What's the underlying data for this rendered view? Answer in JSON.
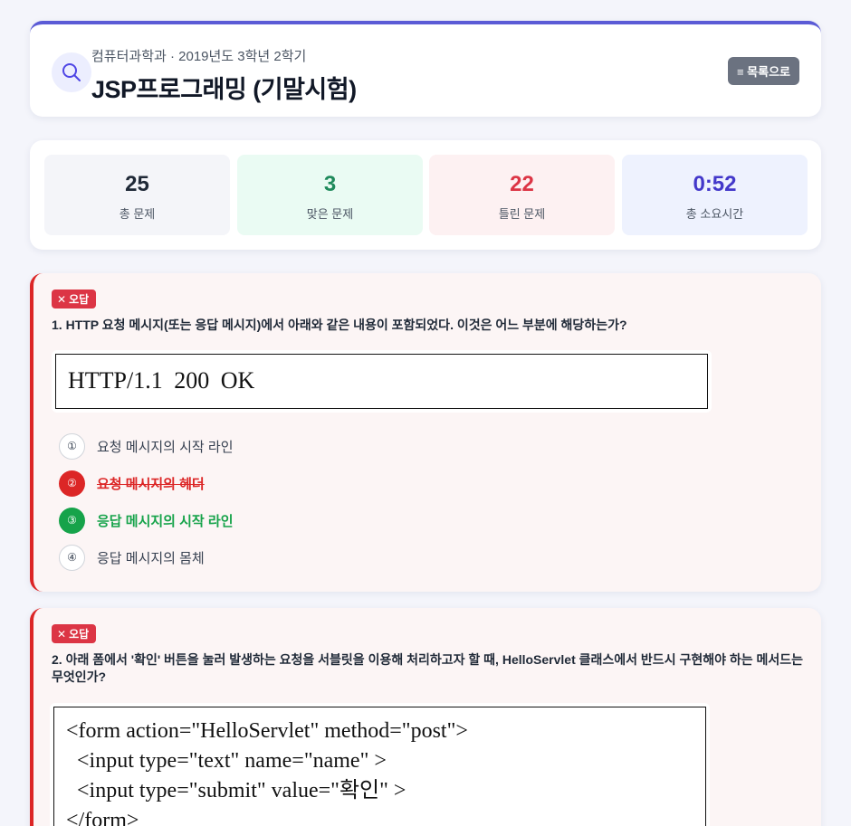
{
  "header": {
    "subtitle": "컴퓨터과학과 · 2019년도 3학년 2학기",
    "title": "JSP프로그래밍 (기말시험)",
    "list_button": "≡ 목록으로"
  },
  "stats": [
    {
      "value": "25",
      "label": "총 문제",
      "color": "#1f2937",
      "bg": "#f4f5f9"
    },
    {
      "value": "3",
      "label": "맞은 문제",
      "color": "#1f8a5b",
      "bg": "#eafbf3"
    },
    {
      "value": "22",
      "label": "틀린 문제",
      "color": "#dc3545",
      "bg": "#fdf1f2"
    },
    {
      "value": "0:52",
      "label": "총 소요시간",
      "color": "#4338ca",
      "bg": "#eef2fe"
    }
  ],
  "questions": [
    {
      "badge": "오답",
      "text": "1. HTTP 요청 메시지(또는 응답 메시지)에서 아래와 같은 내용이 포함되었다. 이것은 어느 부분에 해당하는가?",
      "code": "HTTP/1.1 200 OK",
      "options": [
        {
          "num": "①",
          "text": "요청 메시지의 시작 라인",
          "state": "neutral"
        },
        {
          "num": "②",
          "text": "요청 메시지의 헤더",
          "state": "wrong"
        },
        {
          "num": "③",
          "text": "응답 메시지의 시작 라인",
          "state": "right"
        },
        {
          "num": "④",
          "text": "응답 메시지의 몸체",
          "state": "neutral"
        }
      ]
    },
    {
      "badge": "오답",
      "text": "2. 아래 폼에서 '확인' 버튼을 눌러 발생하는 요청을 서블릿을 이용해 처리하고자 할 때, HelloServlet 클래스에서 반드시 구현해야 하는 메서드는 무엇인가?",
      "code": "<form action=\"HelloServlet\" method=\"post\">\n  <input type=\"text\" name=\"name\" >\n  <input type=\"submit\" value=\"확인\" >\n</form>"
    }
  ]
}
